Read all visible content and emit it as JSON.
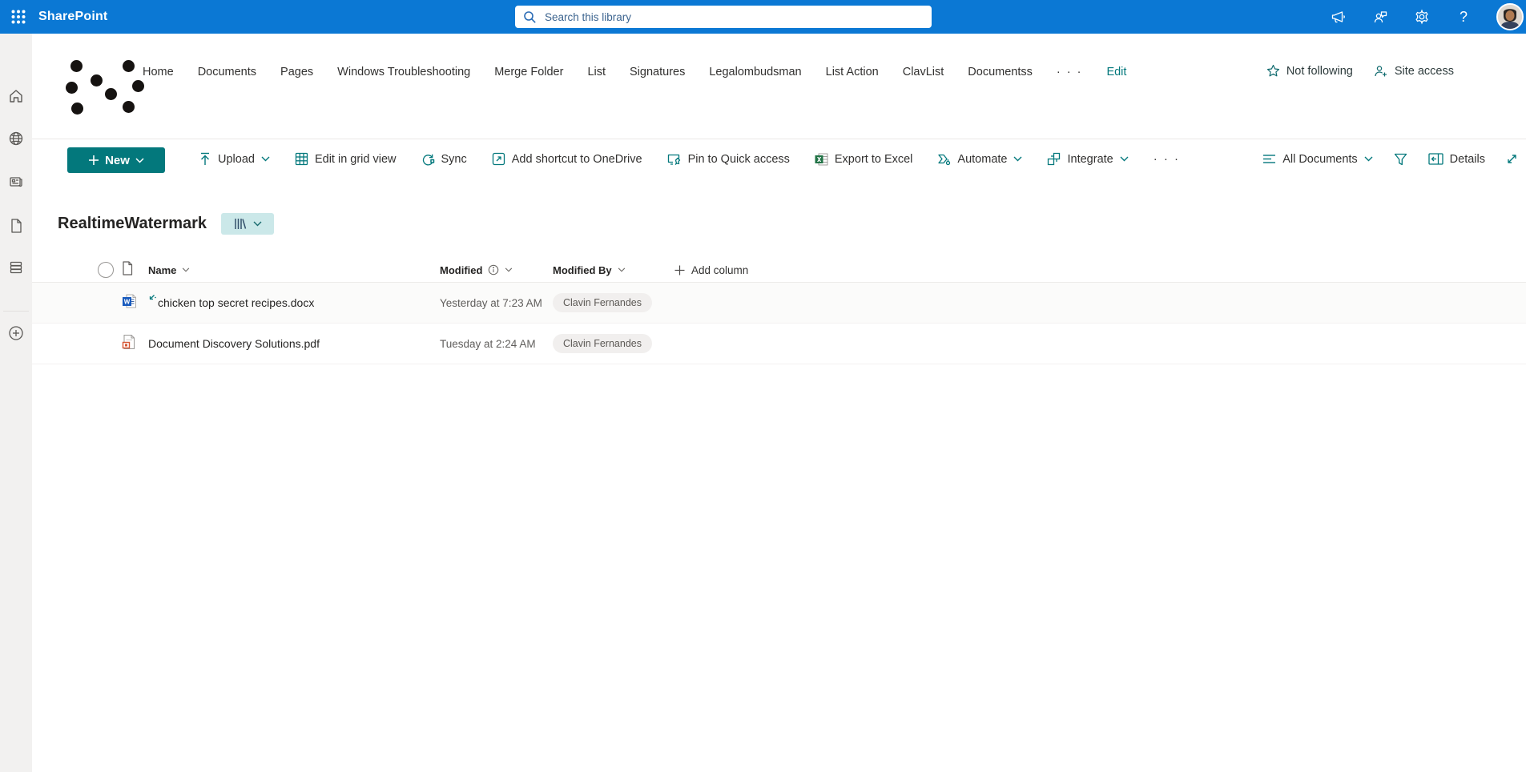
{
  "colors": {
    "suite_bar": "#0b78d4",
    "accent_teal": "#03787c",
    "badge_teal": "#cbe8e9",
    "rail_gray": "#f2f1f0",
    "pill_gray": "#f1efee",
    "excel_green": "#217346",
    "word_blue": "#185abd",
    "pdf_orange": "#d65532"
  },
  "suite_bar": {
    "brand": "SharePoint",
    "search_placeholder": "Search this library",
    "icons": [
      "app-launcher-icon",
      "megaphone-icon",
      "feedback-icon",
      "gear-icon",
      "help-icon",
      "avatar"
    ]
  },
  "rail_icons": [
    "home-icon",
    "globe-icon",
    "news-icon",
    "document-icon",
    "lists-icon",
    "create-plus-icon"
  ],
  "site_nav": {
    "items": [
      "Home",
      "Documents",
      "Pages",
      "Windows Troubleshooting",
      "Merge Folder",
      "List",
      "Signatures",
      "Legalombudsman",
      "List Action",
      "ClavList",
      "Documentss"
    ],
    "overflow": "· · ·",
    "edit_label": "Edit"
  },
  "site_actions": {
    "follow_label": "Not following",
    "site_access_label": "Site access"
  },
  "command_bar": {
    "new_label": "New",
    "items": [
      {
        "label": "Upload",
        "icon": "upload-icon",
        "has_chevron": true
      },
      {
        "label": "Edit in grid view",
        "icon": "grid-view-icon",
        "has_chevron": false
      },
      {
        "label": "Sync",
        "icon": "sync-icon",
        "has_chevron": false
      },
      {
        "label": "Add shortcut to OneDrive",
        "icon": "shortcut-icon",
        "has_chevron": false
      },
      {
        "label": "Pin to Quick access",
        "icon": "pin-icon",
        "has_chevron": false
      },
      {
        "label": "Export to Excel",
        "icon": "excel-icon",
        "has_chevron": false
      },
      {
        "label": "Automate",
        "icon": "automate-icon",
        "has_chevron": true
      },
      {
        "label": "Integrate",
        "icon": "integrate-icon",
        "has_chevron": true
      }
    ],
    "overflow": "· · ·",
    "view_label": "All Documents",
    "details_label": "Details"
  },
  "library": {
    "title": "RealtimeWatermark"
  },
  "table": {
    "columns": {
      "name": "Name",
      "modified": "Modified",
      "modified_by": "Modified By",
      "add_column": "Add column"
    },
    "rows": [
      {
        "name": "chicken top secret recipes.docx",
        "file_type": "word",
        "modified": "Yesterday at 7:23 AM",
        "modified_by": "Clavin Fernandes",
        "is_new": true
      },
      {
        "name": "Document Discovery Solutions.pdf",
        "file_type": "pdf",
        "modified": "Tuesday at 2:24 AM",
        "modified_by": "Clavin Fernandes",
        "is_new": false
      }
    ]
  }
}
